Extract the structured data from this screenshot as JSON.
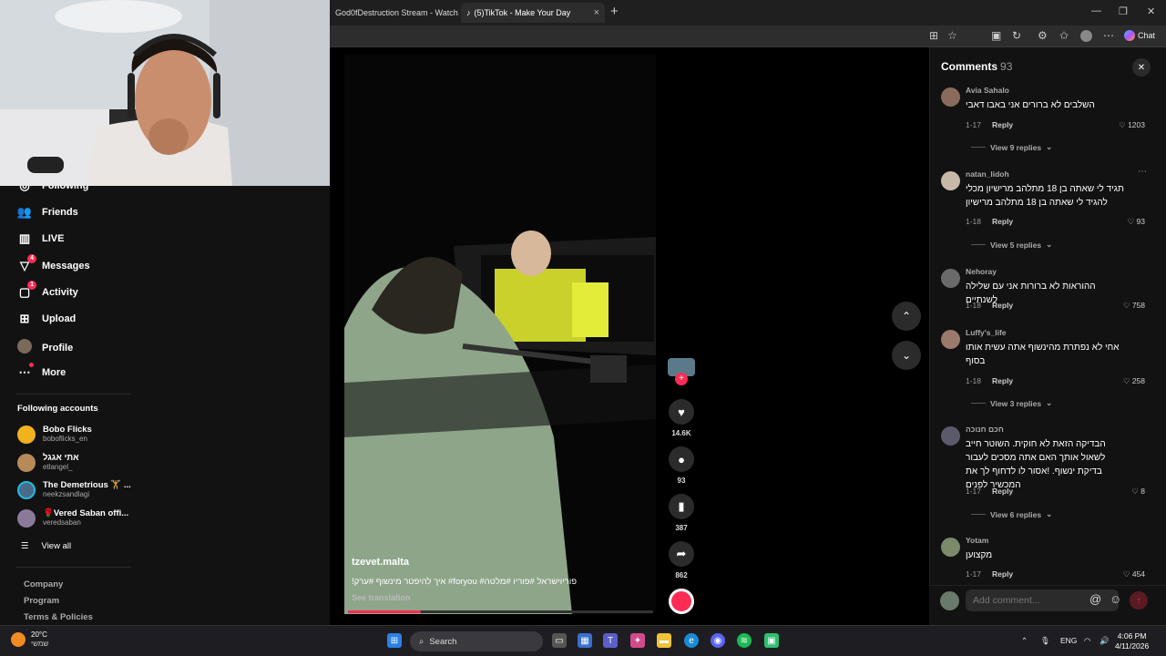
{
  "browser": {
    "tabs": [
      {
        "title": "God0fDestruction Stream - Watch",
        "close": "×"
      },
      {
        "title": "(5)TikTok - Make Your Day",
        "close": "×"
      }
    ],
    "new_tab": "+",
    "window_controls": {
      "minimize": "—",
      "maximize": "❐",
      "close": "✕"
    },
    "chat_label": "Chat"
  },
  "nav": {
    "items": [
      {
        "label": "Following"
      },
      {
        "label": "Friends"
      },
      {
        "label": "LIVE"
      },
      {
        "label": "Messages",
        "badge": "4"
      },
      {
        "label": "Activity",
        "badge": "1"
      },
      {
        "label": "Upload"
      },
      {
        "label": "Profile"
      },
      {
        "label": "More"
      }
    ],
    "following_title": "Following accounts",
    "accounts": [
      {
        "name": "Bobo Flicks",
        "handle": "boboflicks_en",
        "color": "#f2b21e"
      },
      {
        "name": "אתי אגגל",
        "handle": "etlangel_",
        "color": "#b88a5a"
      },
      {
        "name": "The Demetrious 🏋️ ...",
        "handle": "neekzsandlagi",
        "color": "#4a6a8a"
      },
      {
        "name": "🌹Vered Saban offi...",
        "handle": "veredsaban",
        "color": "#8a7a9a"
      }
    ],
    "view_all": "View all",
    "footer": [
      "Company",
      "Program",
      "Terms & Policies"
    ]
  },
  "video": {
    "author": "tzevet.malta",
    "caption": "!איך להיפטר מינשוף    #ערק #foryou #פוריוישראל #פוריו #מלטה",
    "see_translation": "See translation",
    "progress": 0.24,
    "actions": {
      "likes": "14.6K",
      "comments": "93",
      "saves": "387",
      "shares": "862"
    }
  },
  "comments_panel": {
    "title": "Comments",
    "count": "93",
    "comments": [
      {
        "user": "Avia Sahalo",
        "text": "השלבים לא ברורים אני באבו דאבי",
        "date": "1-17",
        "reply": "Reply",
        "likes": "1203",
        "view_replies": "View 9 replies",
        "color": "#8a6a5a"
      },
      {
        "user": "natan_lidoh",
        "text": "תגיד לי שאתה בן 18 מתלהב מרישיון מכלי להגיד לי שאתה בן 18 מתלהב מרישיון",
        "date": "1-18",
        "reply": "Reply",
        "likes": "93",
        "view_replies": "View 5 replies",
        "color": "#c8b8a8"
      },
      {
        "user": "Nehoray",
        "text": "ההוראות לא ברורות אני עם שלילה לשנתיים",
        "date": "1-18",
        "reply": "Reply",
        "likes": "758",
        "view_replies": "",
        "color": "#6a6a6a"
      },
      {
        "user": "Luffy's_life",
        "text": "אחי לא נפתרת מהינשוף אתה עשית אותו בסוף",
        "date": "1-18",
        "reply": "Reply",
        "likes": "258",
        "view_replies": "View 3 replies",
        "color": "#9a7a6a"
      },
      {
        "user": "חכם חנוכה",
        "text": "הבדיקה הזאת לא חוקית. השוטר חייב לשאול אותך האם אתה מסכים לעבור בדיקת ינשוף. !אסור לו לדחוף לך את המכשיר לפנים",
        "date": "1-17",
        "reply": "Reply",
        "likes": "8",
        "view_replies": "View 6 replies",
        "color": "#5a5a6a"
      },
      {
        "user": "Yotam",
        "text": "מקצוען",
        "date": "1-17",
        "reply": "Reply",
        "likes": "454",
        "view_replies": "",
        "color": "#7a8a6a"
      }
    ],
    "add_placeholder": "Add comment..."
  },
  "taskbar": {
    "weather_temp": "20°C",
    "weather_desc": "שמשי",
    "search_label": "Search",
    "lang": "ENG",
    "time": "4:06 PM",
    "date": "4/11/2026"
  }
}
